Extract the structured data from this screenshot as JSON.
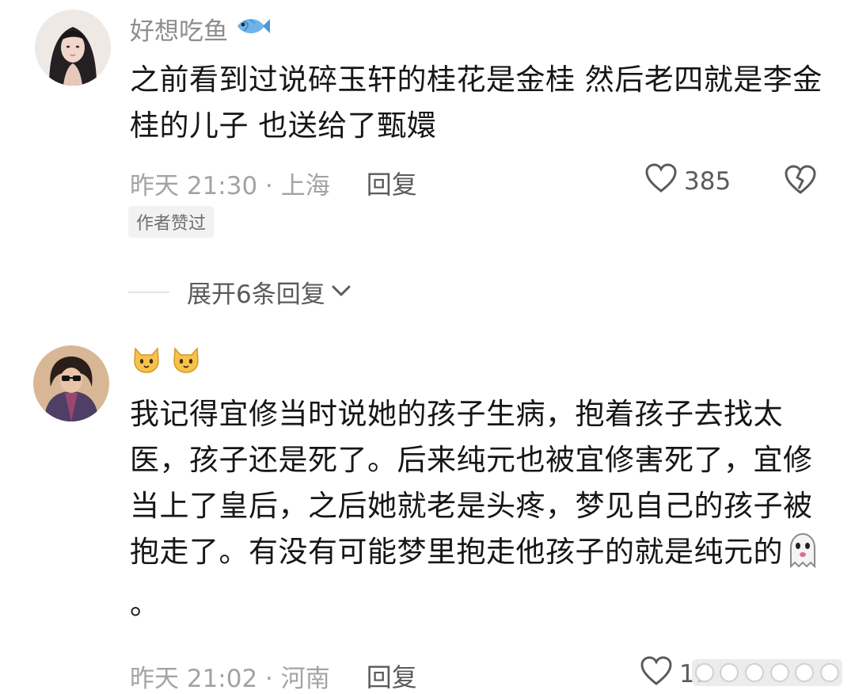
{
  "comments": [
    {
      "username": "好想吃鱼",
      "username_emoji": "fish-emoji",
      "text": "之前看到过说碎玉轩的桂花是金桂 然后老四就是李金桂的儿子 也送给了甄嬛",
      "meta": "昨天 21:30 · 上海",
      "reply_label": "回复",
      "likes": "385",
      "author_liked": "作者赞过",
      "expand_replies": "展开6条回复"
    },
    {
      "username_emojis": [
        "cat-face-emoji",
        "cat-face-emoji"
      ],
      "text": "我记得宜修当时说她的孩子生病，抱着孩子去找太医，孩子还是死了。后来纯元也被宜修害死了，宜修当上了皇后，之后她就老是头疼，梦见自己的孩子被抱走了。有没有可能梦里抱走他孩子的就是纯元的",
      "text_suffix_emoji": "ghost-emoji",
      "text_end": "。",
      "meta": "昨天 21:02 · 河南",
      "reply_label": "回复",
      "likes": "11"
    }
  ],
  "colors": {
    "text": "#161616",
    "secondary": "#8d8d8d",
    "meta": "#a3a3a3",
    "icon": "#5b5b5b"
  }
}
